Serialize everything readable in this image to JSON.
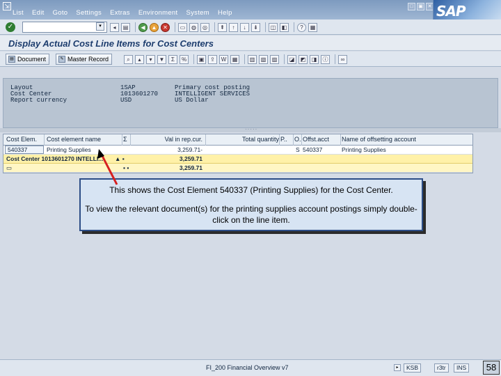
{
  "menubar": {
    "items": [
      "List",
      "Edit",
      "Goto",
      "Settings",
      "Extras",
      "Environment",
      "System",
      "Help"
    ],
    "window_buttons": [
      "□",
      "▣",
      "✕"
    ],
    "logo": "SAP"
  },
  "toolbar1": {
    "command_value": "",
    "dropdown_glyph": "▾"
  },
  "title": "Display Actual Cost Line Items for Cost Centers",
  "toolbar2": {
    "document_button": "Document",
    "master_record_button": "Master Record"
  },
  "header": {
    "rows": [
      {
        "label": "Layout",
        "value": "1SAP",
        "desc": "Primary cost posting"
      },
      {
        "label": "Cost Center",
        "value": "1013601270",
        "desc": "INTELLIGENT SERVICES"
      },
      {
        "label": "Report currency",
        "value": "USD",
        "desc": "US Dollar"
      }
    ]
  },
  "grid": {
    "columns": [
      "Cost Elem.",
      "Cost element name",
      "Σ",
      "Val in rep.cur.",
      "Total quantity",
      "P..",
      "O..",
      "Offst.acct",
      "Name of offsetting account"
    ],
    "rows": [
      {
        "cost_elem": "540337",
        "name": "Printing Supplies",
        "sigma": "",
        "value": "3,259.71-",
        "qty": "",
        "p": "",
        "o": "S",
        "offset": "540337",
        "offset_name": "Printing Supplies"
      }
    ],
    "total_row": {
      "label": "Cost Center 1013601270 INTELLI...",
      "marker": "▲ ▪",
      "value": "3,259.71"
    },
    "grand_total": {
      "marker": "▪ ▪",
      "value": "3,259.71"
    }
  },
  "callout": {
    "line1": "This shows the Cost Element 540337 (Printing Supplies) for the Cost Center.",
    "line2": "To view the relevant document(s) for the printing supplies account postings simply double-click on the line item."
  },
  "statusbar": {
    "text": "FI_200 Financial Overview v7",
    "system": "KSB",
    "client": "r3tr",
    "mode": "INS"
  },
  "slide_number": "58",
  "colors": {
    "total_row": "#fff1a8",
    "callout_bg": "#d7e4f3",
    "callout_border": "#2c4d86",
    "arrow": "#d62020"
  }
}
